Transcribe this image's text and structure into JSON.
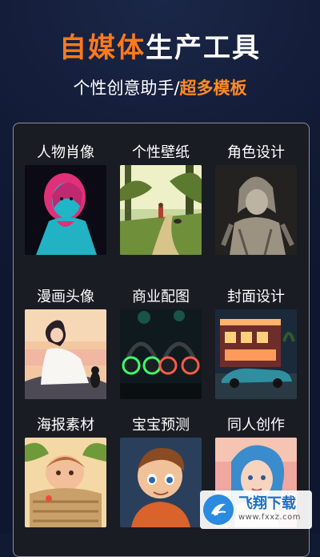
{
  "header": {
    "title_accent": "自媒体",
    "title_plain": "生产工具",
    "subtitle_plain": "个性创意助手/",
    "subtitle_accent": "超多模板"
  },
  "categories": [
    {
      "label": "人物肖像",
      "icon": "neon-portrait-image"
    },
    {
      "label": "个性壁纸",
      "icon": "forest-path-image"
    },
    {
      "label": "角色设计",
      "icon": "stone-character-image"
    },
    {
      "label": "漫画头像",
      "icon": "anime-girl-image"
    },
    {
      "label": "商业配图",
      "icon": "headphones-image"
    },
    {
      "label": "封面设计",
      "icon": "retro-car-image"
    },
    {
      "label": "海报素材",
      "icon": "baby-poster-image"
    },
    {
      "label": "宝宝预测",
      "icon": "cartoon-boy-image"
    },
    {
      "label": "同人创作",
      "icon": "fan-art-girl-image"
    }
  ],
  "watermark": {
    "title": "飞翔下载",
    "url": "www.fxxz.com"
  },
  "colors": {
    "accent": "#ff7a1a",
    "background": "#111a33",
    "card": "#1a1c23"
  }
}
